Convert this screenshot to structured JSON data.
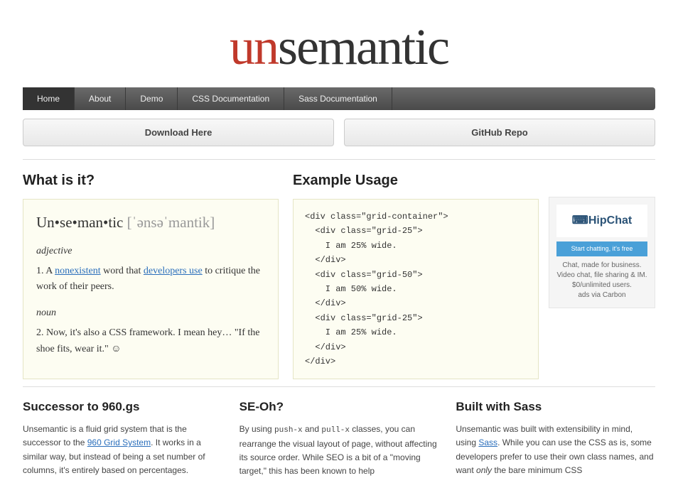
{
  "logo": {
    "un": "un",
    "rest": "semantic"
  },
  "nav": {
    "items": [
      {
        "label": "Home",
        "active": true
      },
      {
        "label": "About",
        "active": false
      },
      {
        "label": "Demo",
        "active": false
      },
      {
        "label": "CSS Documentation",
        "active": false
      },
      {
        "label": "Sass Documentation",
        "active": false
      }
    ]
  },
  "buttons": {
    "download": "Download Here",
    "github": "GitHub Repo"
  },
  "whatisit": {
    "heading": "What is it?",
    "word": "Un•se•man•tic",
    "pron": "[ˈənsəˈmantik]",
    "pos1": "adjective",
    "def1_pre": "1. A ",
    "def1_link1": "nonexistent",
    "def1_mid": " word that ",
    "def1_link2": "developers use",
    "def1_post": " to critique the work of their peers.",
    "pos2": "noun",
    "def2": "2. Now, it's also a CSS framework. I mean hey… \"If the shoe fits, wear it.\" ☺"
  },
  "example": {
    "heading": "Example Usage",
    "code": "<div class=\"grid-container\">\n  <div class=\"grid-25\">\n    I am 25% wide.\n  </div>\n  <div class=\"grid-50\">\n    I am 50% wide.\n  </div>\n  <div class=\"grid-25\">\n    I am 25% wide.\n  </div>\n</div>"
  },
  "ad": {
    "logo": "⌨HipChat",
    "cta": "Start chatting, it's free",
    "body": "Chat, made for business. Video chat, file sharing & IM. $0/unlimited users.",
    "via": "ads via Carbon"
  },
  "tri": {
    "col1": {
      "heading": "Successor to 960.gs",
      "text_pre": "Unsemantic is a fluid grid system that is the successor to the ",
      "link": "960 Grid System",
      "text_post": ". It works in a similar way, but instead of being a set number of columns, it's entirely based on percentages."
    },
    "col2": {
      "heading": "SE-Oh?",
      "text_pre": "By using ",
      "code1": "push-x",
      "text_mid1": " and ",
      "code2": "pull-x",
      "text_post": " classes, you can rearrange the visual layout of page, without affecting its source order. While SEO is a bit of a \"moving target,\" this has been known to help"
    },
    "col3": {
      "heading": "Built with Sass",
      "text_pre": "Unsemantic was built with extensibility in mind, using ",
      "link": "Sass",
      "text_mid": ". While you can use the CSS as is, some developers prefer to use their own class names, and want ",
      "em": "only",
      "text_post": " the bare minimum CSS"
    }
  }
}
